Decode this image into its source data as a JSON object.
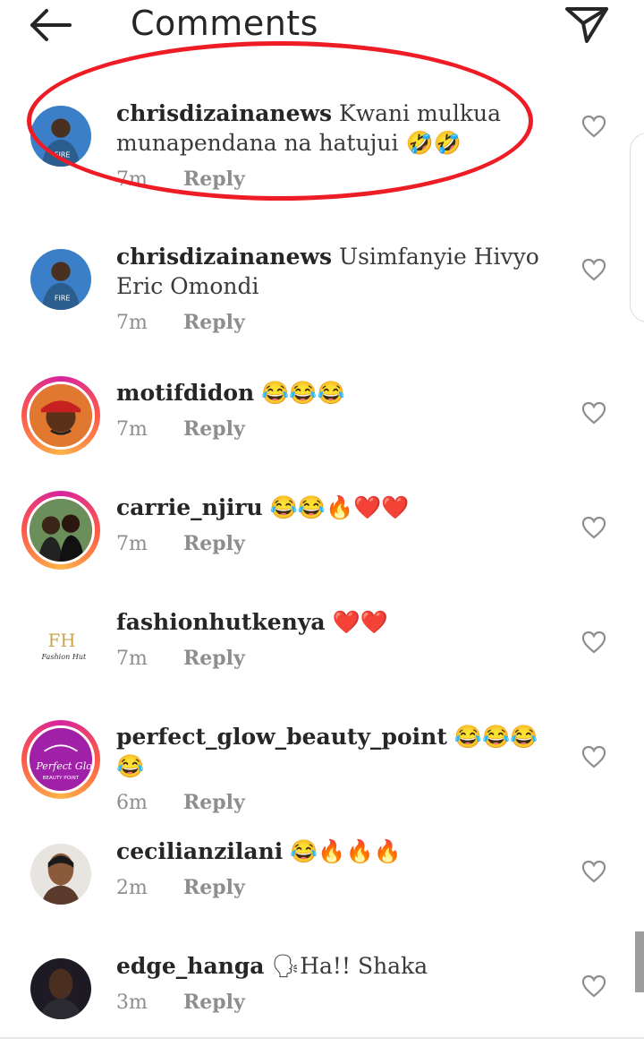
{
  "header": {
    "title": "Comments",
    "back_icon": "arrow-left-icon",
    "send_icon": "paper-plane-icon"
  },
  "reply_label": "Reply",
  "comments": [
    {
      "username": "chrisdizainanews",
      "text": "Kwani mulkua munapendana na hatujui 🤣🤣",
      "time": "7m",
      "ring": false,
      "avatar": "fire-shirt-man"
    },
    {
      "username": "chrisdizainanews",
      "text": "Usimfanyie Hivyo Eric Omondi",
      "time": "7m",
      "ring": false,
      "avatar": "fire-shirt-man"
    },
    {
      "username": "motifdidon",
      "text": "😂😂😂",
      "time": "7m",
      "ring": true,
      "avatar": "red-cap-cartoon"
    },
    {
      "username": "carrie_njiru",
      "text": "😂😂🔥❤️❤️",
      "time": "7m",
      "ring": true,
      "avatar": "two-women-photo"
    },
    {
      "username": "fashionhutkenya",
      "text": "❤️❤️",
      "time": "7m",
      "ring": false,
      "avatar": "fashion-hut-logo"
    },
    {
      "username": "perfect_glow_beauty_point",
      "text": "😂😂😂😂",
      "time": "6m",
      "ring": true,
      "avatar": "perfect-glow-logo"
    },
    {
      "username": "cecilianzilani",
      "text": "😂🔥🔥🔥",
      "time": "2m",
      "ring": false,
      "avatar": "woman-portrait"
    },
    {
      "username": "edge_hanga",
      "text": "🗣Ha!! Shaka",
      "time": "3m",
      "ring": false,
      "avatar": "man-portrait"
    }
  ],
  "colors": {
    "highlight": "#ee1c25",
    "meta": "#8e8e8e",
    "text": "#262626"
  }
}
